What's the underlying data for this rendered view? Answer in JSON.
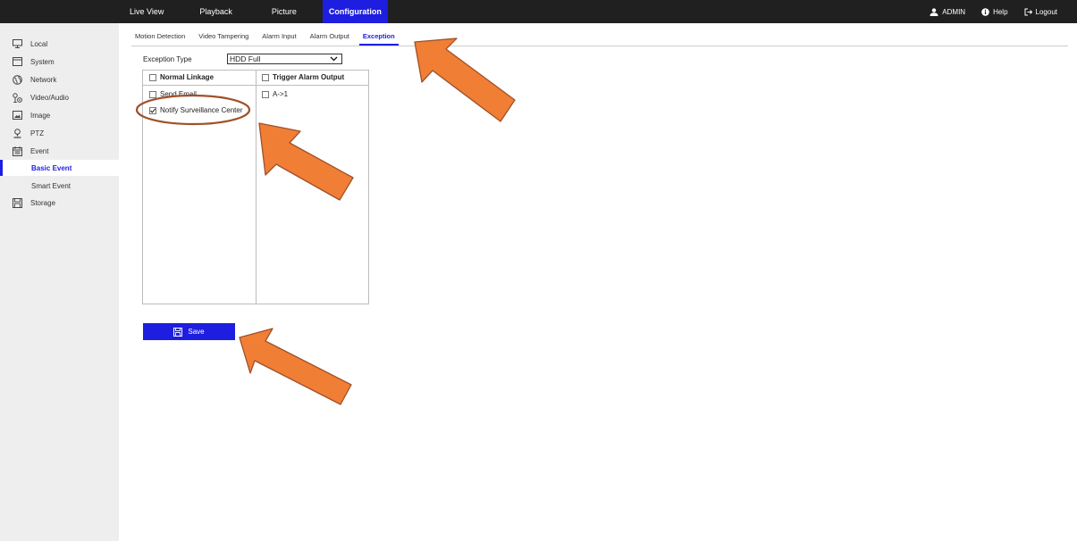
{
  "topnav": {
    "items": [
      {
        "label": "Live View"
      },
      {
        "label": "Playback"
      },
      {
        "label": "Picture"
      },
      {
        "label": "Configuration",
        "active": true
      }
    ],
    "user": "ADMIN",
    "help": "Help",
    "logout": "Logout"
  },
  "sidebar": {
    "items": [
      {
        "label": "Local",
        "icon": "monitor-icon"
      },
      {
        "label": "System",
        "icon": "system-icon"
      },
      {
        "label": "Network",
        "icon": "globe-icon"
      },
      {
        "label": "Video/Audio",
        "icon": "video-audio-icon"
      },
      {
        "label": "Image",
        "icon": "image-icon"
      },
      {
        "label": "PTZ",
        "icon": "ptz-icon"
      },
      {
        "label": "Event",
        "icon": "calendar-icon"
      },
      {
        "label": "Basic Event",
        "sub": true,
        "active": true
      },
      {
        "label": "Smart Event",
        "sub": true
      },
      {
        "label": "Storage",
        "icon": "storage-icon"
      }
    ]
  },
  "tabs": [
    {
      "label": "Motion Detection"
    },
    {
      "label": "Video Tampering"
    },
    {
      "label": "Alarm Input"
    },
    {
      "label": "Alarm Output"
    },
    {
      "label": "Exception",
      "active": true
    }
  ],
  "exception": {
    "label": "Exception Type",
    "selected": "HDD Full"
  },
  "linkage": {
    "normal_header": "Normal Linkage",
    "normal_items": [
      {
        "label": "Send Email",
        "checked": false
      },
      {
        "label": "Notify Surveillance Center",
        "checked": true
      }
    ],
    "trigger_header": "Trigger Alarm Output",
    "trigger_items": [
      {
        "label": "A->1",
        "checked": false
      }
    ]
  },
  "save_label": "Save",
  "colors": {
    "accent": "#1e1ee0",
    "topbar": "#202020",
    "sidebar": "#eeeeee",
    "annotation_arrow": "#f07f35",
    "annotation_outline": "#a0502a"
  }
}
